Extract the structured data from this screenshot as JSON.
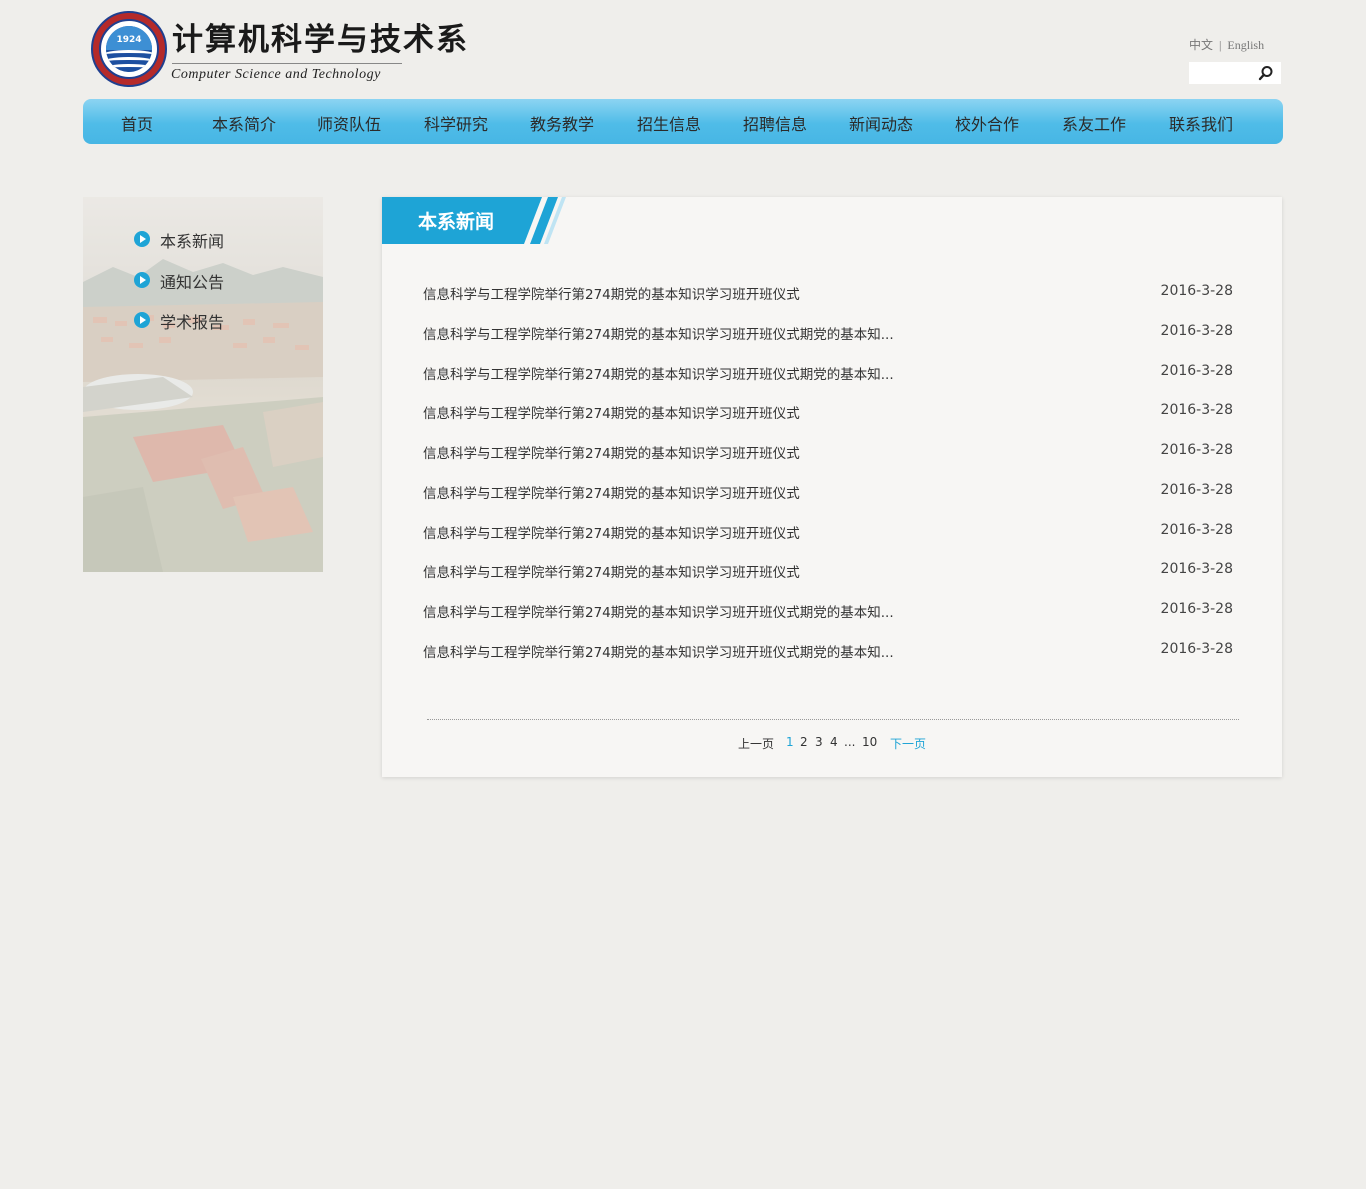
{
  "header": {
    "logo_title": "计算机科学与技术系",
    "logo_subtitle": "Computer Science and Technology",
    "seal_year": "1924",
    "lang_zh": "中文",
    "lang_sep": "|",
    "lang_en": "English",
    "search_placeholder": ""
  },
  "nav": {
    "items": [
      {
        "label": "首页"
      },
      {
        "label": "本系简介"
      },
      {
        "label": "师资队伍"
      },
      {
        "label": "科学研究"
      },
      {
        "label": "教务教学"
      },
      {
        "label": "招生信息"
      },
      {
        "label": "招聘信息"
      },
      {
        "label": "新闻动态"
      },
      {
        "label": "校外合作"
      },
      {
        "label": "系友工作"
      },
      {
        "label": "联系我们"
      }
    ]
  },
  "sidebar": {
    "items": [
      {
        "label": "本系新闻"
      },
      {
        "label": "通知公告"
      },
      {
        "label": "学术报告"
      }
    ]
  },
  "main": {
    "section_title": "本系新闻",
    "news": [
      {
        "title": "信息科学与工程学院举行第274期党的基本知识学习班开班仪式",
        "date": "2016-3-28"
      },
      {
        "title": "信息科学与工程学院举行第274期党的基本知识学习班开班仪式期党的基本知...",
        "date": "2016-3-28"
      },
      {
        "title": "信息科学与工程学院举行第274期党的基本知识学习班开班仪式期党的基本知...",
        "date": "2016-3-28"
      },
      {
        "title": "信息科学与工程学院举行第274期党的基本知识学习班开班仪式",
        "date": "2016-3-28"
      },
      {
        "title": "信息科学与工程学院举行第274期党的基本知识学习班开班仪式",
        "date": "2016-3-28"
      },
      {
        "title": "信息科学与工程学院举行第274期党的基本知识学习班开班仪式",
        "date": "2016-3-28"
      },
      {
        "title": "信息科学与工程学院举行第274期党的基本知识学习班开班仪式",
        "date": "2016-3-28"
      },
      {
        "title": "信息科学与工程学院举行第274期党的基本知识学习班开班仪式",
        "date": "2016-3-28"
      },
      {
        "title": "信息科学与工程学院举行第274期党的基本知识学习班开班仪式期党的基本知...",
        "date": "2016-3-28"
      },
      {
        "title": "信息科学与工程学院举行第274期党的基本知识学习班开班仪式期党的基本知...",
        "date": "2016-3-28"
      }
    ]
  },
  "pager": {
    "prev": "上一页",
    "pages": [
      "1",
      "2",
      "3",
      "4"
    ],
    "ellipsis": "...",
    "last": "10",
    "next": "下一页",
    "current": "1"
  },
  "colors": {
    "accent": "#1ea4d6",
    "nav_top": "#8cd4f2",
    "nav_bottom": "#47b6e4",
    "page_bg": "#efeeeb",
    "panel_bg": "#f7f6f4"
  },
  "icons": {
    "search": "magnifier-icon",
    "sidebar_bullet": "play-circle-icon"
  }
}
